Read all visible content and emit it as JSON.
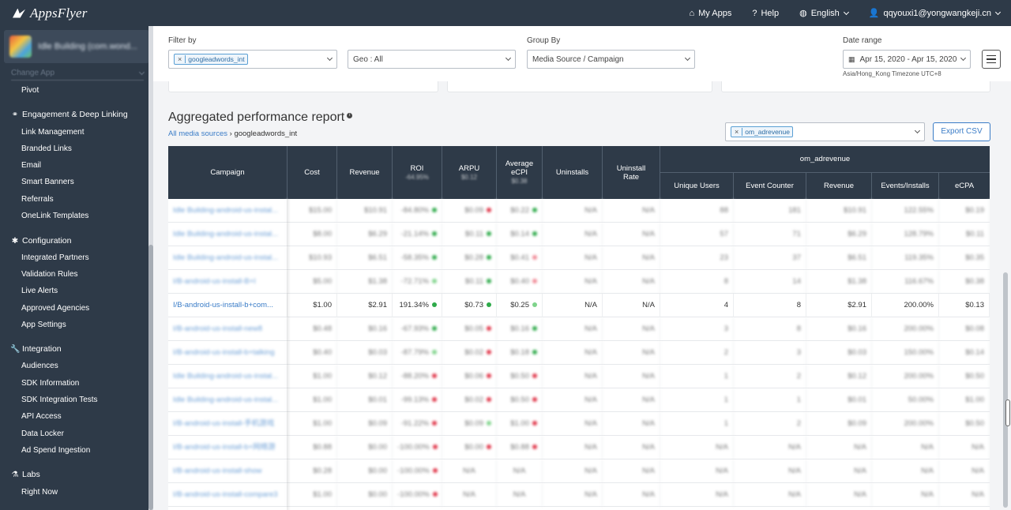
{
  "topbar": {
    "brand": "AppsFlyer",
    "nav": [
      {
        "icon": "home-icon",
        "glyph": "⌂",
        "label": "My Apps"
      },
      {
        "icon": "help-icon",
        "glyph": "?",
        "label": "Help"
      },
      {
        "icon": "globe-icon",
        "glyph": "◍",
        "label": "English"
      },
      {
        "icon": "user-icon",
        "glyph": "👤",
        "label": "qqyouxi1@yongwangkeji.cn"
      }
    ]
  },
  "sidebar": {
    "app_name": "Idle Building (com.wond...",
    "change_app": "Change App",
    "items": [
      {
        "type": "item",
        "label": "Pivot"
      },
      {
        "type": "section",
        "icon": "link-icon",
        "glyph": "⚭",
        "label": "Engagement & Deep Linking"
      },
      {
        "type": "item",
        "label": "Link Management"
      },
      {
        "type": "item",
        "label": "Branded Links"
      },
      {
        "type": "item",
        "label": "Email"
      },
      {
        "type": "item",
        "label": "Smart Banners"
      },
      {
        "type": "item",
        "label": "Referrals"
      },
      {
        "type": "item",
        "label": "OneLink Templates"
      },
      {
        "type": "section",
        "icon": "gear-icon",
        "glyph": "✱",
        "label": "Configuration"
      },
      {
        "type": "item",
        "label": "Integrated Partners"
      },
      {
        "type": "item",
        "label": "Validation Rules"
      },
      {
        "type": "item",
        "label": "Live Alerts"
      },
      {
        "type": "item",
        "label": "Approved Agencies"
      },
      {
        "type": "item",
        "label": "App Settings"
      },
      {
        "type": "section",
        "icon": "wrench-icon",
        "glyph": "🔧",
        "label": "Integration"
      },
      {
        "type": "item",
        "label": "Audiences"
      },
      {
        "type": "item",
        "label": "SDK Information"
      },
      {
        "type": "item",
        "label": "SDK Integration Tests"
      },
      {
        "type": "item",
        "label": "API Access"
      },
      {
        "type": "item",
        "label": "Data Locker"
      },
      {
        "type": "item",
        "label": "Ad Spend Ingestion"
      },
      {
        "type": "section",
        "icon": "flask-icon",
        "glyph": "⚗",
        "label": "Labs"
      },
      {
        "type": "item",
        "label": "Right Now"
      }
    ]
  },
  "filters": {
    "filter_by_label": "Filter by",
    "filter_tag": "googleadwords_int",
    "geo_value": "Geo : All",
    "group_by_label": "Group By",
    "group_by_value": "Media Source / Campaign",
    "date_range_label": "Date range",
    "date_range_value": "Apr 15, 2020 - Apr 15, 2020",
    "timezone": "Asia/Hong_Kong Timezone UTC+8"
  },
  "report": {
    "title": "Aggregated performance report",
    "breadcrumb_root": "All media sources",
    "breadcrumb_sep": "›",
    "breadcrumb_current": "googleadwords_int",
    "event_tag": "om_adrevenue",
    "export_label": "Export CSV"
  },
  "table": {
    "headers": {
      "campaign": "Campaign",
      "cost": "Cost",
      "revenue": "Revenue",
      "roi": "ROI",
      "roi_sub": "-64.95%",
      "arpu": "ARPU",
      "arpu_sub": "$0.12",
      "ecpi": "Average eCPI",
      "ecpi_sub": "$0.38",
      "uninstalls": "Uninstalls",
      "uninstall_rate": "Uninstall Rate",
      "group": "om_adrevenue",
      "unique_users": "Unique Users",
      "event_counter": "Event Counter",
      "ev_revenue": "Revenue",
      "events_installs": "Events/Installs",
      "ecpa": "eCPA"
    },
    "colors": {
      "green": "#2eaa4a",
      "red": "#e0384b",
      "lightgreen": "#7fd38b",
      "lightred": "#f08a96"
    },
    "rows": [
      {
        "blur": true,
        "campaign": "Idle Building-android-us-instal...",
        "cost": "$15.00",
        "revenue": "$10.91",
        "roi": "-84.80%",
        "roi_dot": "green",
        "arpu": "$0.09",
        "arpu_dot": "red",
        "ecpi": "$0.22",
        "ecpi_dot": "green",
        "uninstalls": "N/A",
        "urate": "N/A",
        "uu": "88",
        "ec": "181",
        "rev": "$10.91",
        "ei": "122.55%",
        "ecpa": "$0.19"
      },
      {
        "blur": true,
        "campaign": "Idle Building-android-us-instal...",
        "cost": "$8.00",
        "revenue": "$6.29",
        "roi": "-21.14%",
        "roi_dot": "green",
        "arpu": "$0.11",
        "arpu_dot": "green",
        "ecpi": "$0.14",
        "ecpi_dot": "green",
        "uninstalls": "N/A",
        "urate": "N/A",
        "uu": "57",
        "ec": "71",
        "rev": "$6.29",
        "ei": "128.79%",
        "ecpa": "$0.11"
      },
      {
        "blur": true,
        "campaign": "Idle Building-android-us-instal...",
        "cost": "$10.93",
        "revenue": "$6.51",
        "roi": "-58.35%",
        "roi_dot": "green",
        "arpu": "$0.28",
        "arpu_dot": "green",
        "ecpi": "$0.41",
        "ecpi_dot": "lightred",
        "uninstalls": "N/A",
        "urate": "N/A",
        "uu": "23",
        "ec": "37",
        "rev": "$6.51",
        "ei": "119.35%",
        "ecpa": "$0.35"
      },
      {
        "blur": true,
        "campaign": "I/B-android-us-install-B+I",
        "cost": "$5.00",
        "revenue": "$1.38",
        "roi": "-72.71%",
        "roi_dot": "lightgreen",
        "arpu": "$0.11",
        "arpu_dot": "green",
        "ecpi": "$0.40",
        "ecpi_dot": "lightred",
        "uninstalls": "N/A",
        "urate": "N/A",
        "uu": "8",
        "ec": "14",
        "rev": "$1.38",
        "ei": "116.67%",
        "ecpa": "$0.38"
      },
      {
        "blur": false,
        "campaign": "I/B-android-us-install-b+com...",
        "cost": "$1.00",
        "revenue": "$2.91",
        "roi": "191.34%",
        "roi_dot": "green",
        "arpu": "$0.73",
        "arpu_dot": "green",
        "ecpi": "$0.25",
        "ecpi_dot": "lightgreen",
        "uninstalls": "N/A",
        "urate": "N/A",
        "uu": "4",
        "ec": "8",
        "rev": "$2.91",
        "ei": "200.00%",
        "ecpa": "$0.13"
      },
      {
        "blur": true,
        "campaign": "I/B-android-us-install-new8",
        "cost": "$0.48",
        "revenue": "$0.16",
        "roi": "-67.93%",
        "roi_dot": "green",
        "arpu": "$0.05",
        "arpu_dot": "red",
        "ecpi": "$0.16",
        "ecpi_dot": "green",
        "uninstalls": "N/A",
        "urate": "N/A",
        "uu": "3",
        "ec": "8",
        "rev": "$0.16",
        "ei": "200.00%",
        "ecpa": "$0.08"
      },
      {
        "blur": true,
        "campaign": "I/B-android-us-install-b+talking",
        "cost": "$0.40",
        "revenue": "$0.03",
        "roi": "-87.79%",
        "roi_dot": "lightgreen",
        "arpu": "$0.02",
        "arpu_dot": "red",
        "ecpi": "$0.18",
        "ecpi_dot": "green",
        "uninstalls": "N/A",
        "urate": "N/A",
        "uu": "2",
        "ec": "3",
        "rev": "$0.03",
        "ei": "150.00%",
        "ecpa": "$0.14"
      },
      {
        "blur": true,
        "campaign": "Idle Building-android-us-instal...",
        "cost": "$1.00",
        "revenue": "$0.12",
        "roi": "-88.20%",
        "roi_dot": "red",
        "arpu": "$0.06",
        "arpu_dot": "red",
        "ecpi": "$0.50",
        "ecpi_dot": "red",
        "uninstalls": "N/A",
        "urate": "N/A",
        "uu": "1",
        "ec": "2",
        "rev": "$0.12",
        "ei": "200.00%",
        "ecpa": "$0.50"
      },
      {
        "blur": true,
        "campaign": "Idle Building-android-us-instal...",
        "cost": "$1.00",
        "revenue": "$0.01",
        "roi": "-99.13%",
        "roi_dot": "red",
        "arpu": "$0.02",
        "arpu_dot": "red",
        "ecpi": "$0.50",
        "ecpi_dot": "red",
        "uninstalls": "N/A",
        "urate": "N/A",
        "uu": "1",
        "ec": "1",
        "rev": "$0.01",
        "ei": "50.00%",
        "ecpa": "$1.00"
      },
      {
        "blur": true,
        "campaign": "I/B-android-us-install-手机游戏",
        "cost": "$1.00",
        "revenue": "$0.09",
        "roi": "-91.22%",
        "roi_dot": "red",
        "arpu": "$0.09",
        "arpu_dot": "lightgreen",
        "ecpi": "$1.00",
        "ecpi_dot": "red",
        "uninstalls": "N/A",
        "urate": "N/A",
        "uu": "1",
        "ec": "2",
        "rev": "$0.09",
        "ei": "200.00%",
        "ecpa": "$0.50"
      },
      {
        "blur": true,
        "campaign": "I/B-android-us-install-b+网络游",
        "cost": "$0.88",
        "revenue": "$0.00",
        "roi": "-100.00%",
        "roi_dot": "red",
        "arpu": "$0.00",
        "arpu_dot": "red",
        "ecpi": "$0.88",
        "ecpi_dot": "red",
        "uninstalls": "N/A",
        "urate": "N/A",
        "uu": "N/A",
        "ec": "N/A",
        "rev": "N/A",
        "ei": "N/A",
        "ecpa": "N/A"
      },
      {
        "blur": true,
        "campaign": "I/B-android-us-install-show",
        "cost": "$0.28",
        "revenue": "$0.00",
        "roi": "-100.00%",
        "roi_dot": "red",
        "arpu": "N/A",
        "arpu_dot": "",
        "ecpi": "N/A",
        "ecpi_dot": "",
        "uninstalls": "N/A",
        "urate": "N/A",
        "uu": "N/A",
        "ec": "N/A",
        "rev": "N/A",
        "ei": "N/A",
        "ecpa": "N/A"
      },
      {
        "blur": true,
        "campaign": "I/B-android-us-install-compare3",
        "cost": "$1.00",
        "revenue": "$0.00",
        "roi": "-100.00%",
        "roi_dot": "red",
        "arpu": "N/A",
        "arpu_dot": "",
        "ecpi": "N/A",
        "ecpi_dot": "",
        "uninstalls": "N/A",
        "urate": "N/A",
        "uu": "N/A",
        "ec": "N/A",
        "rev": "N/A",
        "ei": "N/A",
        "ecpa": "N/A"
      }
    ]
  }
}
